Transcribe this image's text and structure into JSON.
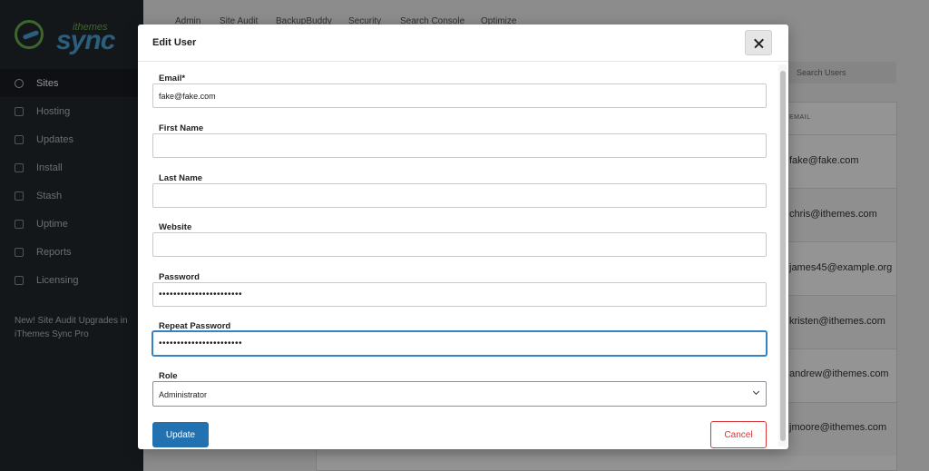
{
  "app": {
    "brand_small": "ithemes",
    "brand_big": "sync"
  },
  "sidebar": {
    "items": [
      {
        "label": "Sites",
        "icon": "sites-icon"
      },
      {
        "label": "Hosting",
        "icon": "hosting-icon"
      },
      {
        "label": "Updates",
        "icon": "updates-icon"
      },
      {
        "label": "Install",
        "icon": "install-icon"
      },
      {
        "label": "Stash",
        "icon": "stash-icon"
      },
      {
        "label": "Uptime",
        "icon": "uptime-icon"
      },
      {
        "label": "Reports",
        "icon": "reports-icon"
      },
      {
        "label": "Licensing",
        "icon": "licensing-icon"
      }
    ],
    "promo": "New! Site Audit Upgrades in iThemes Sync Pro"
  },
  "tabs": [
    "Admin",
    "Site Audit",
    "BackupBuddy",
    "Security",
    "Search Console",
    "Optimize"
  ],
  "users_list": {
    "search_placeholder": "Search Users",
    "email_header": "EMAIL",
    "emails": [
      "fake@fake.com",
      "chris@ithemes.com",
      "james45@example.org",
      "kristen@ithemes.com",
      "andrew@ithemes.com",
      "jmoore@ithemes.com"
    ]
  },
  "modal": {
    "title": "Edit User",
    "fields": {
      "email": {
        "label": "Email*",
        "value": "fake@fake.com"
      },
      "first_name": {
        "label": "First Name",
        "value": ""
      },
      "last_name": {
        "label": "Last Name",
        "value": ""
      },
      "website": {
        "label": "Website",
        "value": ""
      },
      "password": {
        "label": "Password",
        "value": "•••••••••••••••••••••••"
      },
      "repeat_password": {
        "label": "Repeat Password",
        "value": "•••••••••••••••••••••••"
      },
      "role": {
        "label": "Role",
        "value": "Administrator"
      }
    },
    "update_label": "Update",
    "cancel_label": "Cancel"
  },
  "colors": {
    "sidebar_bg": "#23282d",
    "primary": "#2271b1",
    "danger": "#d63638",
    "focus": "#3582c4"
  }
}
